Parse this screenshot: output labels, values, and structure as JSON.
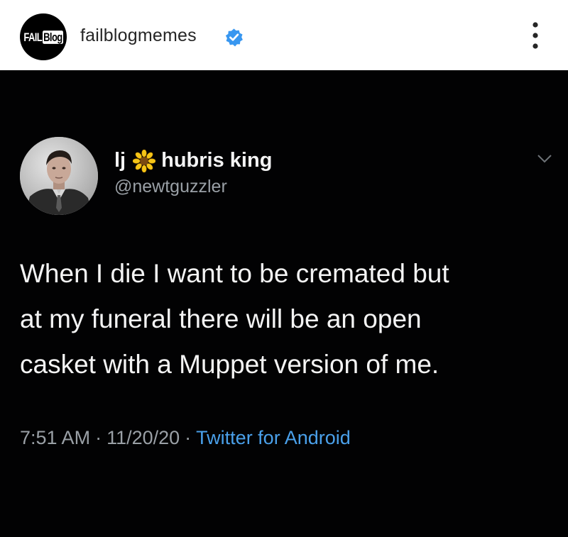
{
  "post": {
    "account_name": "failblogmemes",
    "logo": {
      "part1": "FAIL",
      "part2": "Blog"
    },
    "verified": true,
    "icons": {
      "verified": "verified-badge-icon",
      "more": "more-options-icon"
    }
  },
  "tweet": {
    "display_name_prefix": "lj",
    "display_name_suffix": "hubris king",
    "handle": "@newtguzzler",
    "text_lines": [
      "When I die I want to be cremated but",
      "at my funeral there will be an open",
      "casket with a Muppet version of me."
    ],
    "time": "7:51 AM",
    "date": "11/20/20",
    "separator": "·",
    "source": "Twitter for Android",
    "icons": {
      "flower": "sunflower-icon",
      "caret": "chevron-down-icon"
    }
  },
  "colors": {
    "background_dark": "#020203",
    "text_light": "#f4f4f4",
    "text_muted": "#9aa0a6",
    "link_blue": "#4aa0ea",
    "verified_blue": "#3897f0"
  }
}
